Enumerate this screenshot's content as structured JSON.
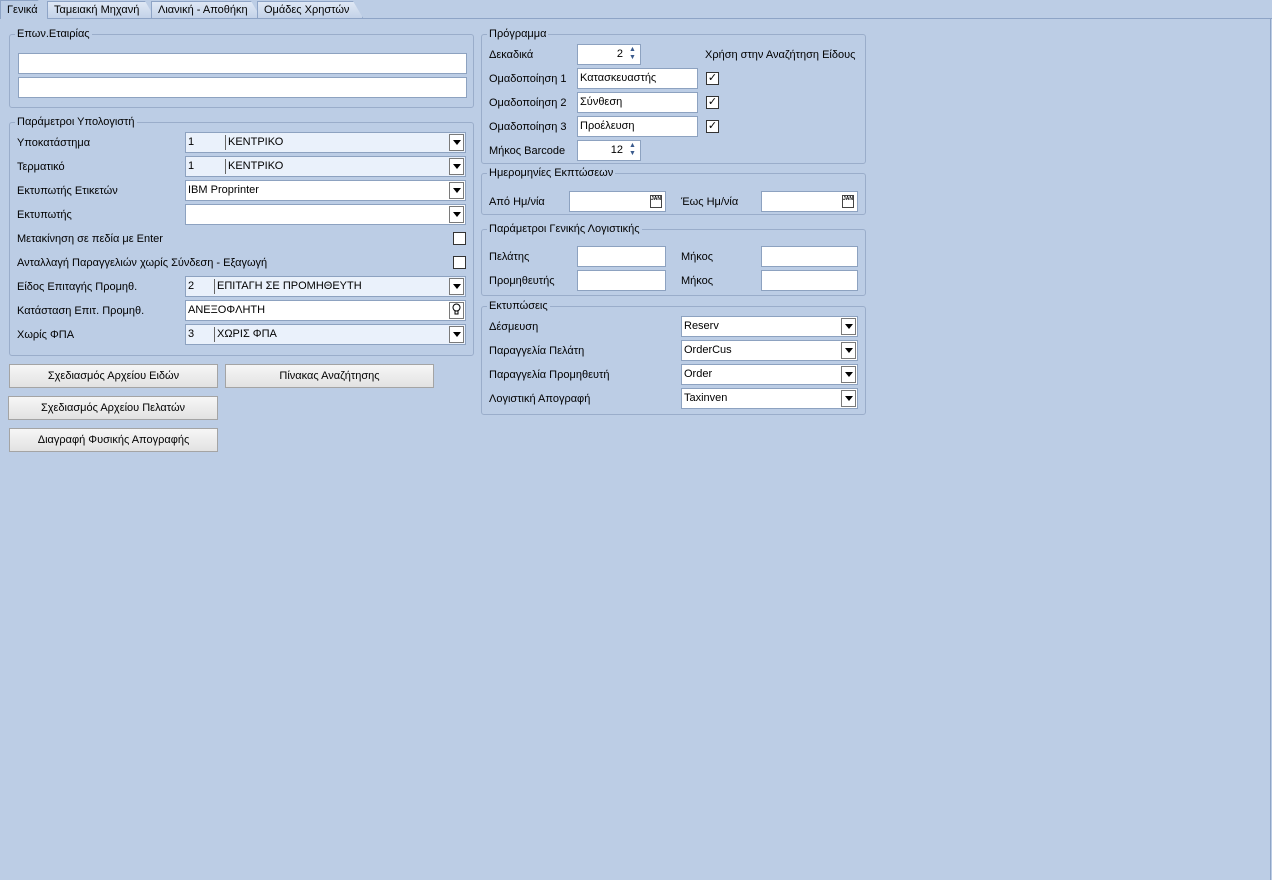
{
  "tabs": [
    "Γενικά",
    "Ταμειακή Μηχανή",
    "Λιανική - Αποθήκη",
    "Ομάδες Χρηστών"
  ],
  "company_group": {
    "title": "Επων.Εταιρίας",
    "line1": "",
    "line2": ""
  },
  "params_group": {
    "title": "Παράμετροι Υπολογιστή",
    "branch": {
      "label": "Υποκατάστημα",
      "code": "1",
      "desc": "ΚΕΝΤΡΙΚΟ"
    },
    "terminal": {
      "label": "Τερματικό",
      "code": "1",
      "desc": "ΚΕΝΤΡΙΚΟ"
    },
    "label_printer": {
      "label": "Εκτυπωτής Ετικετών",
      "value": "IBM Proprinter"
    },
    "printer": {
      "label": "Εκτυπωτής",
      "value": ""
    },
    "enter_move": {
      "label": "Μετακίνηση σε πεδία με Enter",
      "checked": false
    },
    "order_exchange": {
      "label": "Ανταλλαγή Παραγγελιών χωρίς Σύνδεση - Εξαγωγή",
      "checked": false
    },
    "supplier_cheque_type": {
      "label": "Είδος Επιταγής Προμηθ.",
      "code": "2",
      "desc": "ΕΠΙΤΑΓΗ ΣΕ ΠΡΟΜΗΘΕΥΤΗ"
    },
    "supplier_cheque_status": {
      "label": "Κατάσταση Επιτ. Προμηθ.",
      "value": "ΑΝΕΞΟΦΛΗΤΗ"
    },
    "no_vat": {
      "label": "Χωρίς ΦΠΑ",
      "code": "3",
      "desc": "ΧΩΡΙΣ ΦΠΑ"
    }
  },
  "buttons": {
    "items_design": "Σχεδιασμός Αρχείου Ειδών",
    "lookup_table": "Πίνακας Αναζήτησης",
    "customers_design": "Σχεδιασμός Αρχείου Πελατών",
    "delete_inventory": "Διαγραφή Φυσικής Απογραφής"
  },
  "program_group": {
    "title": "Πρόγραμμα",
    "decimals": {
      "label": "Δεκαδικά",
      "value": "2"
    },
    "search_usage_label": "Χρήση στην Αναζήτηση Είδους",
    "grouping": [
      {
        "label": "Ομαδοποίηση 1",
        "value": "Κατασκευαστής",
        "checked": true
      },
      {
        "label": "Ομαδοποίηση 2",
        "value": "Σύνθεση",
        "checked": true
      },
      {
        "label": "Ομαδοποίηση 3",
        "value": "Προέλευση",
        "checked": true
      }
    ],
    "barcode_length": {
      "label": "Μήκος Barcode",
      "value": "12"
    }
  },
  "discount_dates_group": {
    "title": "Ημερομηνίες Εκπτώσεων",
    "from_label": "Από Ημ/νία",
    "from_value": "",
    "to_label": "Έως Ημ/νία",
    "to_value": "",
    "cal_icon_text": "JAN"
  },
  "accounting_group": {
    "title": "Παράμετροι Γενικής Λογιστικής",
    "customer_label": "Πελάτης",
    "customer_value": "",
    "customer_length_label": "Μήκος",
    "customer_length_value": "",
    "supplier_label": "Προμηθευτής",
    "supplier_value": "",
    "supplier_length_label": "Μήκος",
    "supplier_length_value": ""
  },
  "prints_group": {
    "title": "Εκτυπώσεις",
    "rows": [
      {
        "label": "Δέσμευση",
        "value": "Reserv"
      },
      {
        "label": "Παραγγελία Πελάτη",
        "value": "OrderCus"
      },
      {
        "label": "Παραγγελία Προμηθευτή",
        "value": "Order"
      },
      {
        "label": "Λογιστική Απογραφή",
        "value": "Taxinven"
      }
    ]
  },
  "icons": {
    "dropdown": "chevron-down-icon",
    "spin": "spin-icon",
    "calendar": "calendar-icon",
    "lookup": "bulb-icon",
    "check": "✓"
  }
}
